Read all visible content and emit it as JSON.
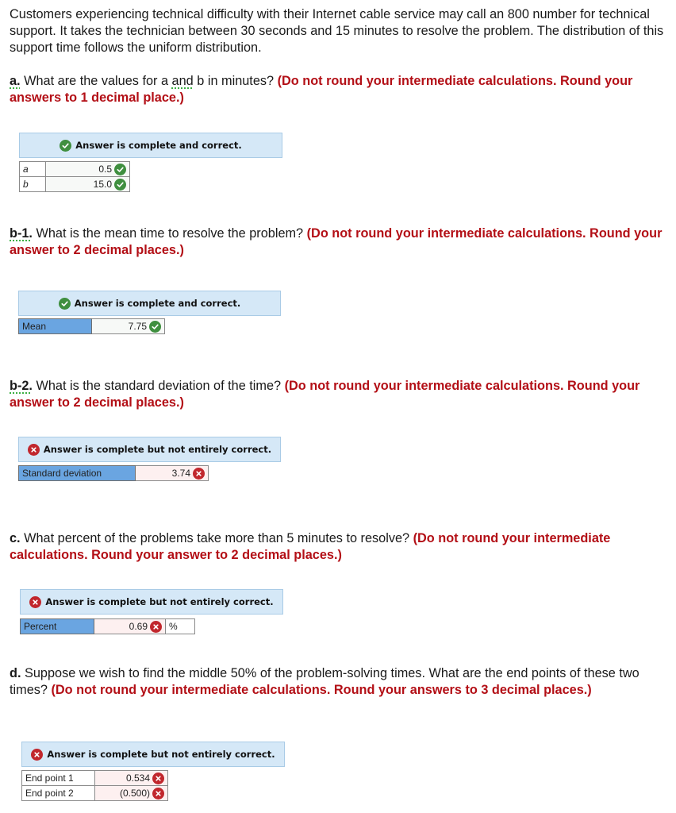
{
  "intro": "Customers experiencing technical difficulty with their Internet cable service may call an 800 number for technical support. It takes the technician between 30 seconds and 15 minutes to resolve the problem. The distribution of this support time follows the uniform distribution.",
  "colors": {
    "instruction_red": "#b30f16",
    "banner_bg": "#d5e8f7",
    "label_blue": "#6aa5e1",
    "correct_green": "#3f8f3f",
    "incorrect_red": "#c1272d"
  },
  "parts": {
    "a": {
      "label": "a.",
      "q1": " What are the values for a ",
      "q_and": "and",
      "q2": " b in minutes? ",
      "instruction": "(Do not round your intermediate calculations. Round your answers to 1 decimal place.)",
      "banner": "Answer is complete and correct.",
      "status": "correct",
      "rows": [
        {
          "label": "a",
          "value": "0.5",
          "status": "correct"
        },
        {
          "label": "b",
          "value": "15.0",
          "status": "correct"
        }
      ]
    },
    "b1": {
      "label": "b-1.",
      "question": " What is the mean time to resolve the problem? ",
      "instruction": "(Do not round your intermediate calculations. Round your answer to 2 decimal places.)",
      "banner": "Answer is complete and correct.",
      "status": "correct",
      "rows": [
        {
          "label": "Mean",
          "value": "7.75",
          "status": "correct"
        }
      ]
    },
    "b2": {
      "label": "b-2.",
      "question": " What is the standard deviation of the time? ",
      "instruction": "(Do not round your intermediate calculations. Round your answer to 2 decimal places.)",
      "banner": "Answer is complete but not entirely correct.",
      "status": "incorrect",
      "rows": [
        {
          "label": "Standard deviation",
          "value": "3.74",
          "status": "incorrect"
        }
      ]
    },
    "c": {
      "label": "c.",
      "question": " What percent of the problems take more than 5 minutes to resolve? ",
      "instruction": "(Do not round your intermediate calculations. Round your answer to 2 decimal places.)",
      "banner": "Answer is complete but not entirely correct.",
      "status": "incorrect",
      "rows": [
        {
          "label": "Percent",
          "value": "0.69",
          "unit": "%",
          "status": "incorrect"
        }
      ]
    },
    "d": {
      "label": "d.",
      "question": " Suppose we wish to find the middle 50% of the problem-solving times. What are the end points of these two times? ",
      "instruction": "(Do not round your intermediate calculations. Round your answers to 3 decimal places.)",
      "banner": "Answer is complete but not entirely correct.",
      "status": "incorrect",
      "rows": [
        {
          "label": "End point 1",
          "value": "0.534",
          "status": "incorrect"
        },
        {
          "label": "End point 2",
          "value": "(0.500)",
          "status": "incorrect"
        }
      ]
    }
  }
}
